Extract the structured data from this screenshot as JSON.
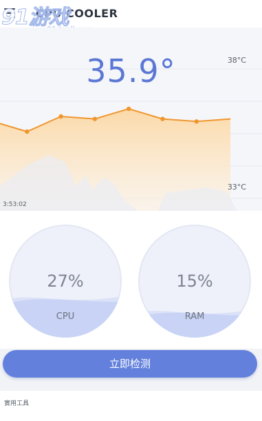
{
  "header": {
    "title": "CPU COOLER",
    "menu_icon": "hamburger-menu-icon"
  },
  "watermark": {
    "main": "91游戏",
    "sub": "91danji.com"
  },
  "temperature": {
    "current": "35.9°",
    "max_label": "38°C",
    "min_label": "33°C",
    "time_label": "3:53:02",
    "history_celsius": [
      35.6,
      35.2,
      35.8,
      35.7,
      36.1,
      35.7,
      35.6,
      35.7
    ],
    "line_color": "#f0962e",
    "fill_color": "#fbd9a8"
  },
  "gauges": {
    "cpu": {
      "value": "27%",
      "label": "CPU",
      "fraction": 0.27
    },
    "ram": {
      "value": "15%",
      "label": "RAM",
      "fraction": 0.15
    }
  },
  "actions": {
    "check_button": "立即检测"
  },
  "tools": {
    "title": "實用工具"
  },
  "colors": {
    "accent": "#6381dc",
    "temp_text": "#5b77d4",
    "gauge_wave": "#c8d3f5"
  }
}
